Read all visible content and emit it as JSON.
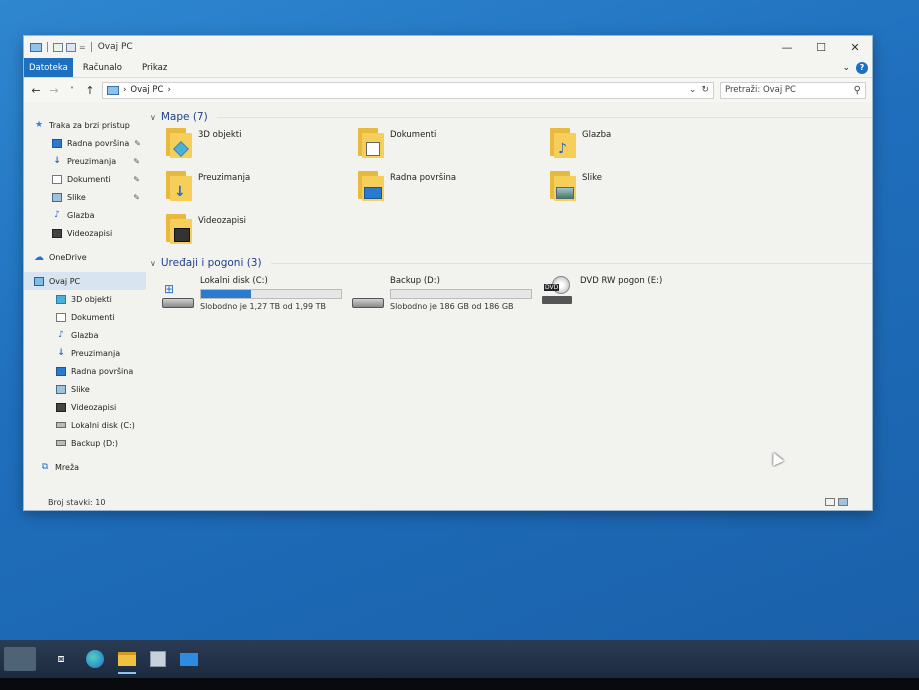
{
  "window": {
    "title": "Ovaj PC",
    "controls": [
      "—",
      "☐",
      "✕"
    ]
  },
  "ribbon": {
    "tabs": [
      "Datoteka",
      "Računalo",
      "Prikaz"
    ],
    "expand": "⌄",
    "help": "?"
  },
  "address": {
    "back": "←",
    "forward": "→",
    "recent": "˅",
    "up": "↑",
    "path": "Ovaj PC",
    "path_sep": "›",
    "dropdown": "⌄",
    "refresh": "↻",
    "search_placeholder": "Pretraži: Ovaj PC",
    "search_icon": "⚲"
  },
  "nav": {
    "quick_access": "Traka za brzi pristup",
    "quick_items": [
      {
        "label": "Radna površina",
        "icon": "desktop-icon",
        "pinned": true
      },
      {
        "label": "Preuzimanja",
        "icon": "downloads-icon",
        "pinned": true
      },
      {
        "label": "Dokumenti",
        "icon": "documents-icon",
        "pinned": true
      },
      {
        "label": "Slike",
        "icon": "pictures-icon",
        "pinned": true
      },
      {
        "label": "Glazba",
        "icon": "music-icon",
        "pinned": false
      },
      {
        "label": "Videozapisi",
        "icon": "videos-icon",
        "pinned": false
      }
    ],
    "pin_glyph": "📌",
    "onedrive": "OneDrive",
    "this_pc": "Ovaj PC",
    "pc_items": [
      "3D objekti",
      "Dokumenti",
      "Glazba",
      "Preuzimanja",
      "Radna površina",
      "Slike",
      "Videozapisi",
      "Lokalni disk (C:)",
      "Backup (D:)"
    ],
    "network": "Mreža"
  },
  "content": {
    "folders_header": "Mape (7)",
    "folders": [
      "3D objekti",
      "Dokumenti",
      "Glazba",
      "Preuzimanja",
      "Radna površina",
      "Slike",
      "Videozapisi"
    ],
    "drives_header": "Uređaji i pogoni (3)",
    "drives": [
      {
        "name": "Lokalni disk (C:)",
        "free": "Slobodno je 1,27 TB od 1,99 TB",
        "used_fraction": 0.36
      },
      {
        "name": "Backup (D:)",
        "free": "Slobodno je 186 GB od 186 GB",
        "used_fraction": 0.0
      }
    ],
    "dvd": {
      "name": "DVD RW pogon (E:)",
      "label": "DVD"
    }
  },
  "status": {
    "count": "Broj stavki: 10"
  },
  "colors": {
    "accent": "#1d6fc0",
    "desktop": "#1f6fbd",
    "folder": "#f6cf5a"
  }
}
